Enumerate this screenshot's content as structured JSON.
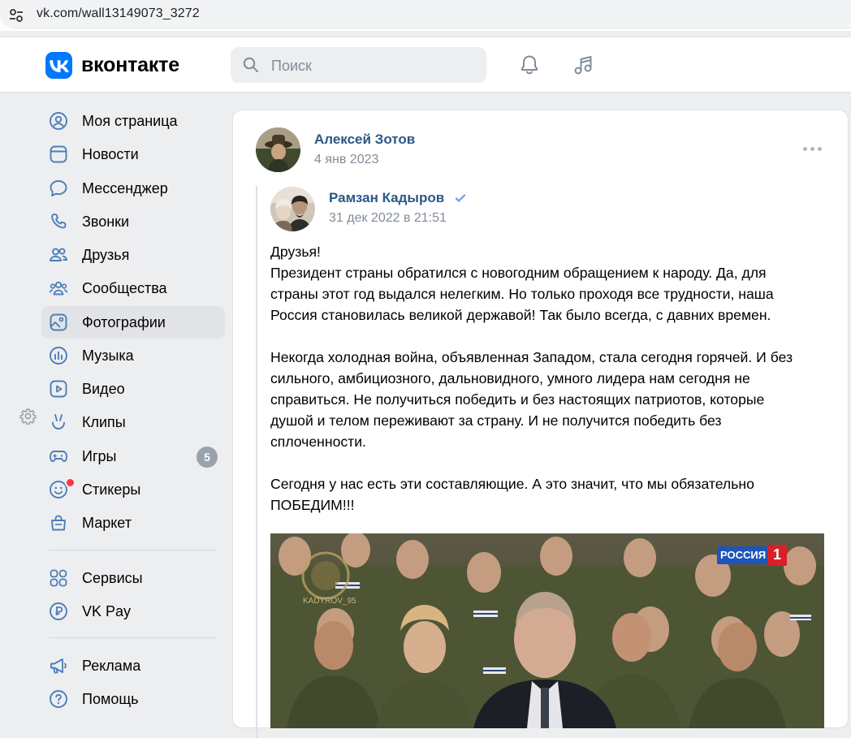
{
  "browser": {
    "url": "vk.com/wall13149073_3272"
  },
  "header": {
    "logo_text": "вконтакте",
    "search_placeholder": "Поиск"
  },
  "sidebar": {
    "items": [
      {
        "label": "Моя страница",
        "icon": "user-circle-icon"
      },
      {
        "label": "Новости",
        "icon": "news-icon"
      },
      {
        "label": "Мессенджер",
        "icon": "message-icon"
      },
      {
        "label": "Звонки",
        "icon": "phone-icon"
      },
      {
        "label": "Друзья",
        "icon": "friends-icon"
      },
      {
        "label": "Сообщества",
        "icon": "communities-icon"
      },
      {
        "label": "Фотографии",
        "icon": "photo-icon",
        "active": true
      },
      {
        "label": "Музыка",
        "icon": "music-icon"
      },
      {
        "label": "Видео",
        "icon": "video-icon"
      },
      {
        "label": "Клипы",
        "icon": "clips-icon"
      },
      {
        "label": "Игры",
        "icon": "games-icon",
        "badge": "5"
      },
      {
        "label": "Стикеры",
        "icon": "stickers-icon"
      },
      {
        "label": "Маркет",
        "icon": "market-icon"
      },
      {
        "label": "Сервисы",
        "icon": "services-icon"
      },
      {
        "label": "VK Pay",
        "icon": "vkpay-icon"
      },
      {
        "label": "Реклама",
        "icon": "ads-icon"
      },
      {
        "label": "Помощь",
        "icon": "help-icon"
      }
    ]
  },
  "post": {
    "author": "Алексей Зотов",
    "date": "4 янв 2023",
    "repost": {
      "author": "Рамзан Кадыров",
      "date": "31 дек 2022 в 21:51",
      "paragraphs": [
        "Друзья!",
        "Президент страны обратился с новогодним обращением к народу. Да, для страны этот год выдался нелегким. Но только проходя все трудности, наша Россия становилась великой державой! Так было всегда, с давних времен.",
        "Некогда холодная война, объявленная Западом, стала сегодня горячей. И без сильного, амбициозного, дальновидного, умного лидера нам сегодня не справиться. Не получиться победить и без настоящих патриотов, которые душой и телом переживают за страну. И не получится победить без сплоченности.",
        "Сегодня у нас есть эти составляющие. А это значит, что мы обязательно ПОБЕДИМ!!!"
      ],
      "photo": {
        "channel_logo": "РОССИЯ",
        "channel_number": "1",
        "watermark": "KADYROV_95"
      }
    }
  },
  "colors": {
    "accent": "#0077ff",
    "link": "#2a5885",
    "secondary": "#818c99",
    "bg": "#edeef0"
  }
}
